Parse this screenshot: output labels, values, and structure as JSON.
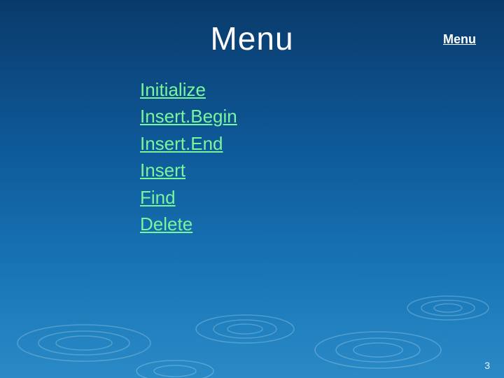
{
  "title": "Menu",
  "top_link": "Menu",
  "menu_items": [
    "Initialize",
    "Insert.Begin",
    "Insert.End",
    "Insert",
    "Find",
    "Delete"
  ],
  "page_number": "3"
}
